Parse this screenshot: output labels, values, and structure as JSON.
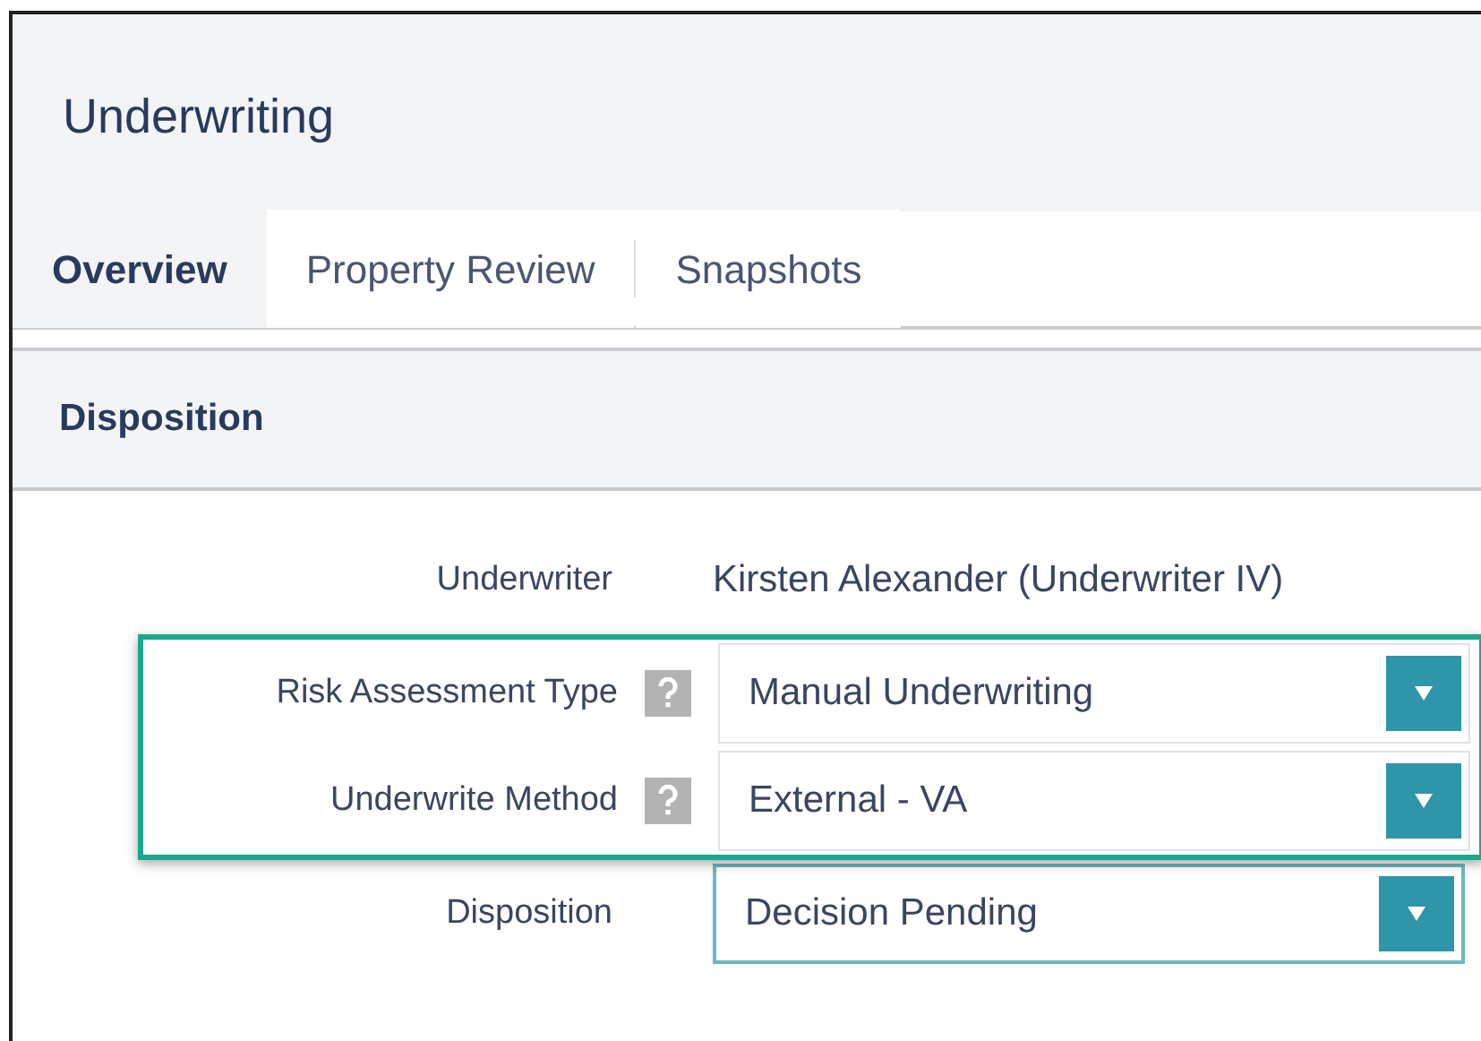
{
  "header": {
    "title": "Underwriting"
  },
  "tabs": [
    {
      "label": "Overview",
      "selected": true
    },
    {
      "label": "Property Review",
      "selected": false
    },
    {
      "label": "Snapshots",
      "selected": false
    }
  ],
  "section": {
    "title": "Disposition"
  },
  "groups": [
    {
      "highlighted": false,
      "fields": [
        {
          "kind": "text",
          "label": "Underwriter",
          "help": false,
          "value": "Kirsten Alexander (Underwriter IV)"
        }
      ]
    },
    {
      "highlighted": true,
      "fields": [
        {
          "kind": "select",
          "label": "Risk Assessment Type",
          "help": true,
          "value": "Manual Underwriting",
          "focused": false
        },
        {
          "kind": "select",
          "label": "Underwrite Method",
          "help": true,
          "value": "External - VA",
          "focused": false
        }
      ]
    },
    {
      "highlighted": false,
      "fields": [
        {
          "kind": "select",
          "label": "Disposition",
          "help": false,
          "value": "Decision Pending",
          "focused": true
        }
      ]
    }
  ]
}
